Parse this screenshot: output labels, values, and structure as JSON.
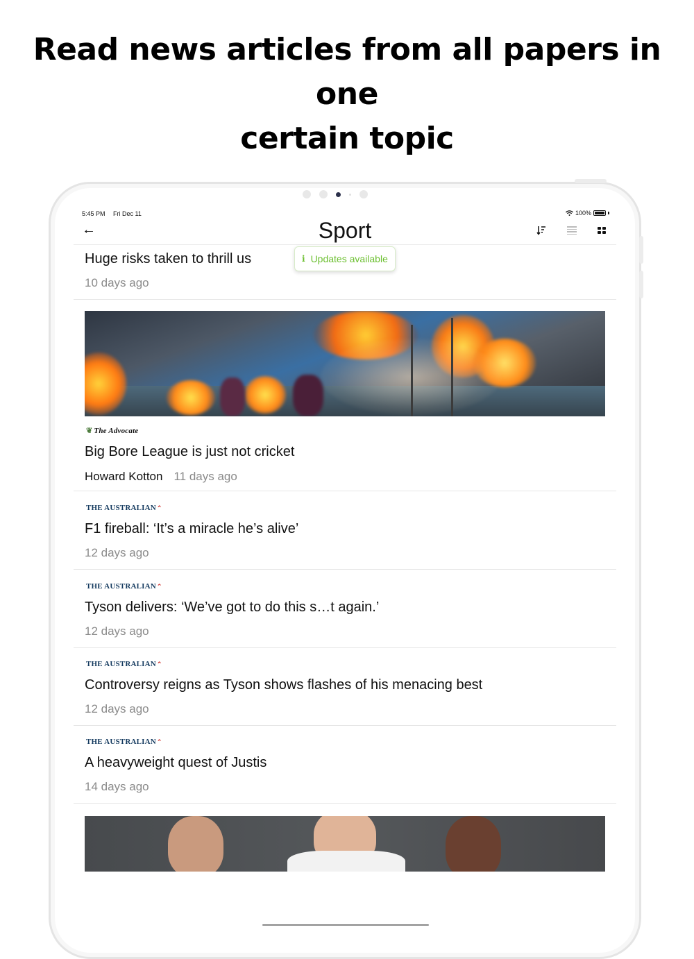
{
  "promo": {
    "line1": "Read news articles from all papers in one",
    "line2": "certain topic"
  },
  "status_bar": {
    "time": "5:45 PM",
    "date": "Fri Dec 11",
    "battery": "100%",
    "icons": [
      "wifi-icon",
      "battery-icon"
    ]
  },
  "nav": {
    "back_glyph": "←",
    "title": "Sport",
    "icons": [
      "sort-icon",
      "list-view-icon",
      "grid-view-icon"
    ]
  },
  "toast": {
    "icon_glyph": "i",
    "text": "Updates available"
  },
  "articles": [
    {
      "source": "",
      "title": "Huge risks taken to thrill us",
      "author": "",
      "time": "10 days ago"
    },
    {
      "source": "The Advocate",
      "title": "Big Bore League is just not cricket",
      "author": "Howard Kotton",
      "time": "11 days ago"
    },
    {
      "source": "THE AUSTRALIAN",
      "title": "F1 fireball: ‘It’s a miracle he’s alive’",
      "author": "",
      "time": "12 days ago"
    },
    {
      "source": "THE AUSTRALIAN",
      "title": "Tyson delivers: ‘We’ve got to do this s…t again.’",
      "author": "",
      "time": "12 days ago"
    },
    {
      "source": "THE AUSTRALIAN",
      "title": "Controversy reigns as Tyson shows flashes of his menacing best",
      "author": "",
      "time": "12 days ago"
    },
    {
      "source": "THE AUSTRALIAN",
      "title": "A heavyweight quest of Justis",
      "author": "",
      "time": "14 days ago"
    }
  ],
  "colors": {
    "accent_green": "#6bbf2f",
    "australian_blue": "#13395e",
    "australian_red": "#d0312d",
    "meta_gray": "#8a8a8a"
  }
}
